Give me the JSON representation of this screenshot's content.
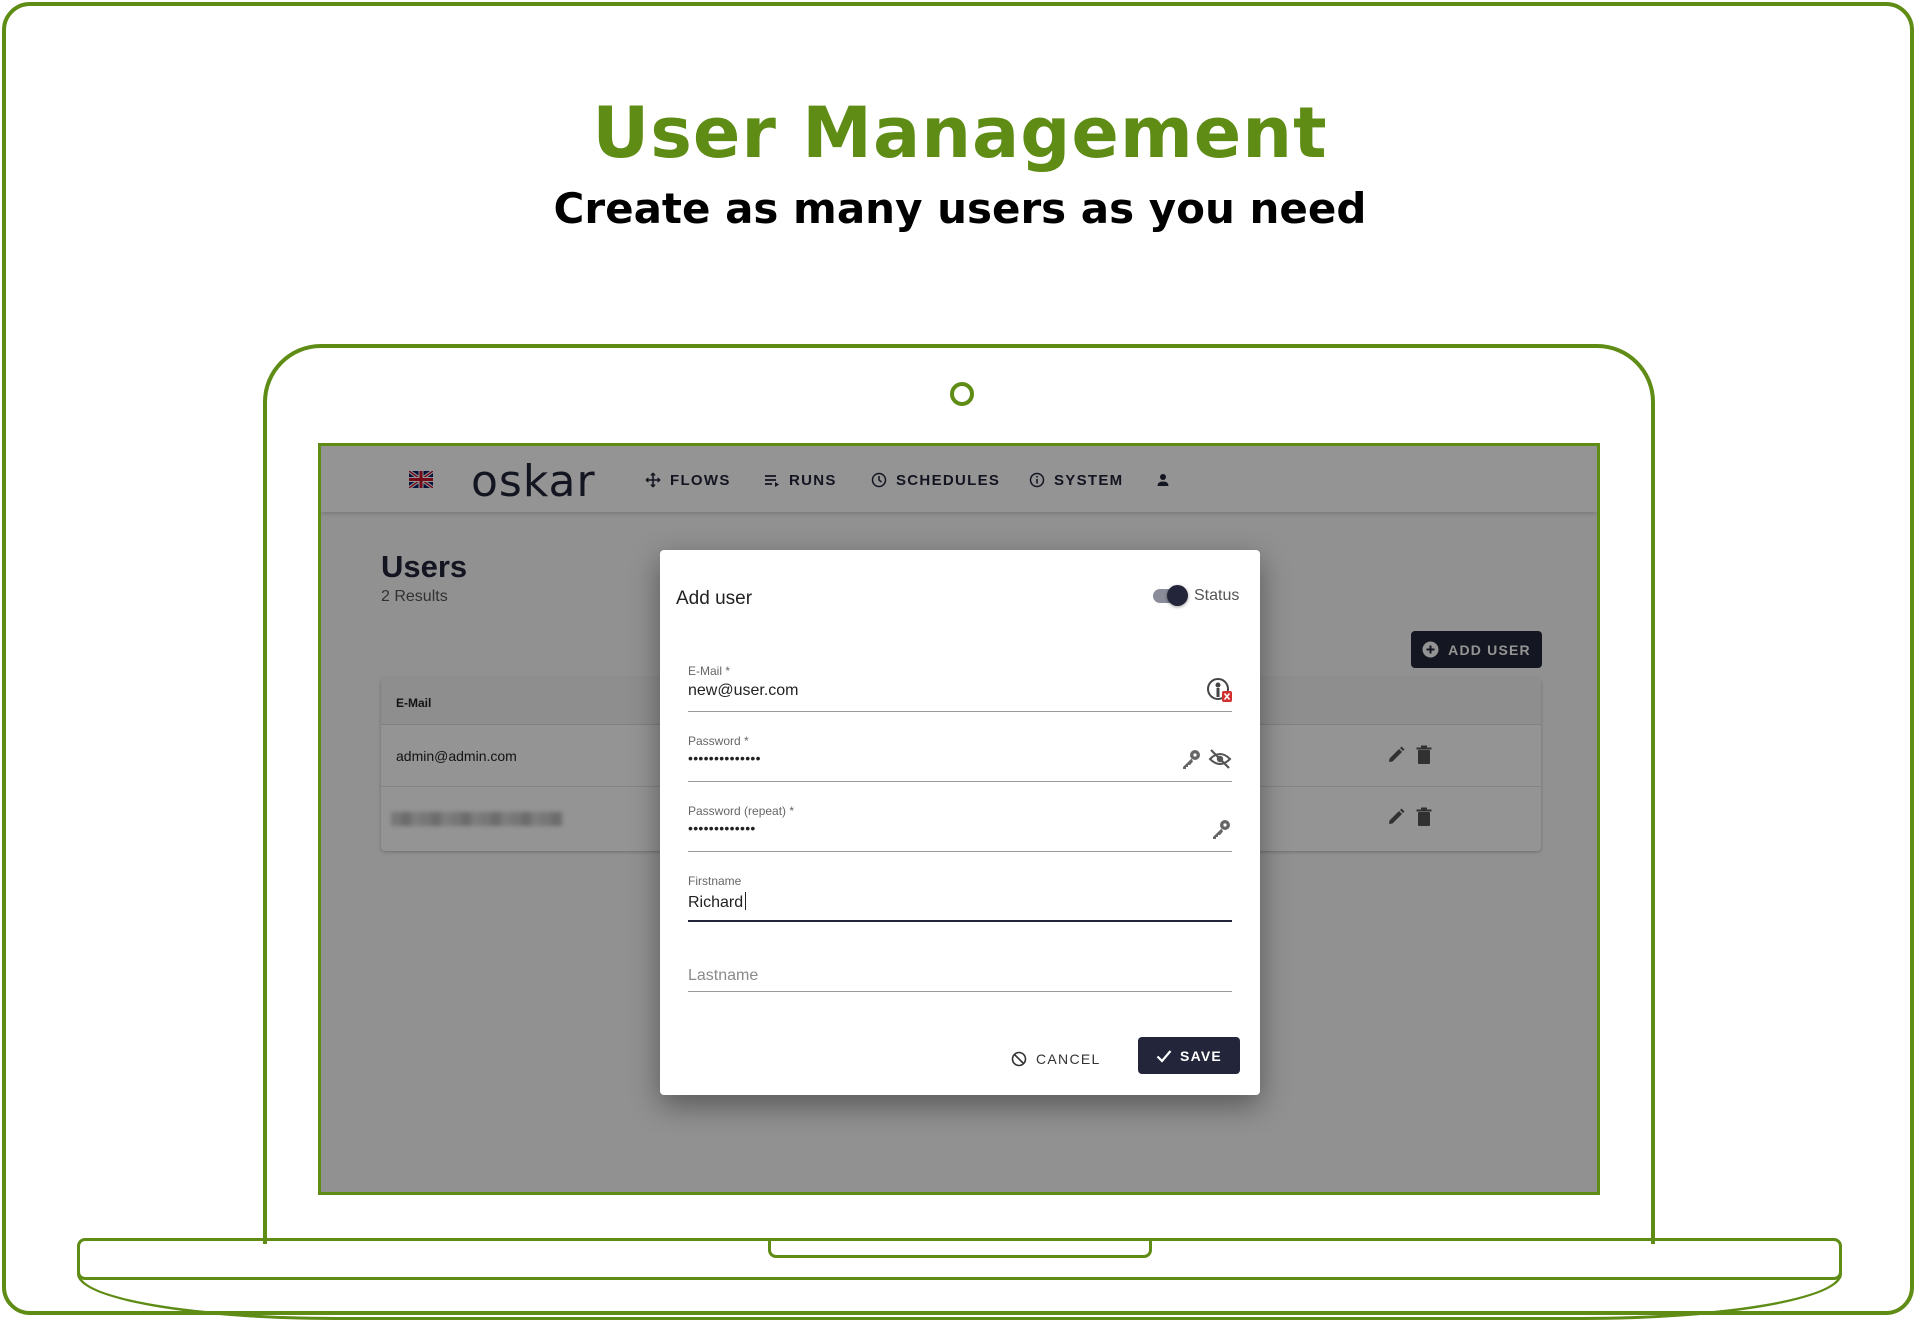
{
  "marketing": {
    "headline": "User Management",
    "subheadline": "Create as many users as you need",
    "accent_color": "#5e8c14"
  },
  "app": {
    "logo": "oskar",
    "nav": [
      {
        "label": "FLOWS",
        "icon": "flows-icon"
      },
      {
        "label": "RUNS",
        "icon": "runs-icon"
      },
      {
        "label": "SCHEDULES",
        "icon": "clock-icon"
      },
      {
        "label": "SYSTEM",
        "icon": "info-icon"
      }
    ],
    "primary_color": "#23263b"
  },
  "users_page": {
    "title": "Users",
    "result_count": "2 Results",
    "add_user_label": "ADD USER",
    "table": {
      "columns": [
        "E-Mail"
      ],
      "rows": [
        {
          "email": "admin@admin.com"
        },
        {
          "email": ""
        }
      ]
    }
  },
  "dialog": {
    "title": "Add user",
    "status_label": "Status",
    "status_on": true,
    "fields": {
      "email": {
        "label": "E-Mail *",
        "value": "new@user.com"
      },
      "password": {
        "label": "Password *",
        "value": "••••••••••••••"
      },
      "password_repeat": {
        "label": "Password (repeat) *",
        "value": "•••••••••••••"
      },
      "firstname": {
        "label": "Firstname",
        "value": "Richard"
      },
      "lastname": {
        "placeholder": "Lastname"
      }
    },
    "cancel_label": "CANCEL",
    "save_label": "SAVE"
  }
}
